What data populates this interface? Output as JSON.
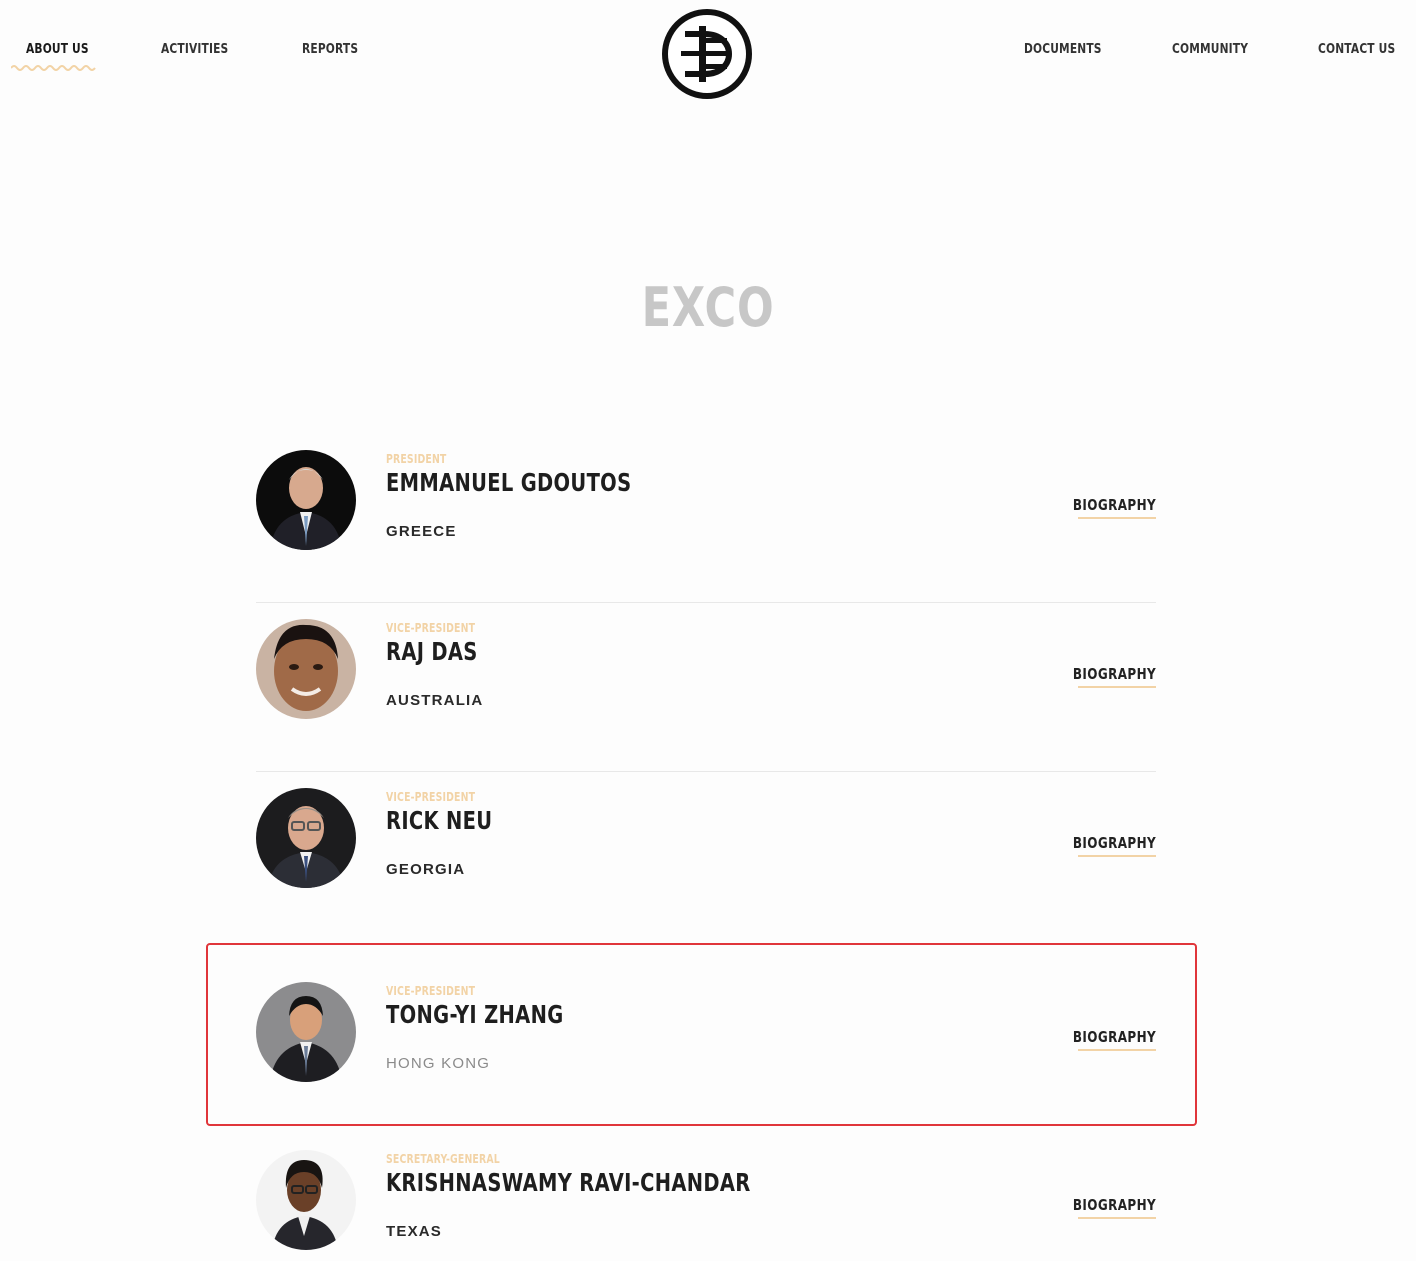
{
  "nav": {
    "left": [
      "ABOUT US",
      "ACTIVITIES",
      "REPORTS"
    ],
    "right": [
      "DOCUMENTS",
      "COMMUNITY",
      "CONTACT US"
    ],
    "active": "ABOUT US"
  },
  "logo": {
    "icon": "monogram-logo"
  },
  "page": {
    "title": "EXCO"
  },
  "members": [
    {
      "role": "PRESIDENT",
      "name": "EMMANUEL GDOUTOS",
      "location": "GREECE",
      "link": "BIOGRAPHY"
    },
    {
      "role": "VICE-PRESIDENT",
      "name": "RAJ DAS",
      "location": "AUSTRALIA",
      "link": "BIOGRAPHY"
    },
    {
      "role": "VICE-PRESIDENT",
      "name": "RICK NEU",
      "location": "GEORGIA",
      "link": "BIOGRAPHY"
    },
    {
      "role": "VICE-PRESIDENT",
      "name": "TONG-YI ZHANG",
      "location": "HONG KONG",
      "link": "BIOGRAPHY"
    },
    {
      "role": "SECRETARY-GENERAL",
      "name": "KRISHNASWAMY RAVI-CHANDAR",
      "location": "TEXAS",
      "link": "BIOGRAPHY"
    }
  ],
  "colors": {
    "accent": "#f2d3a6",
    "highlight": "#e0353a",
    "title": "#c7c7c7"
  }
}
